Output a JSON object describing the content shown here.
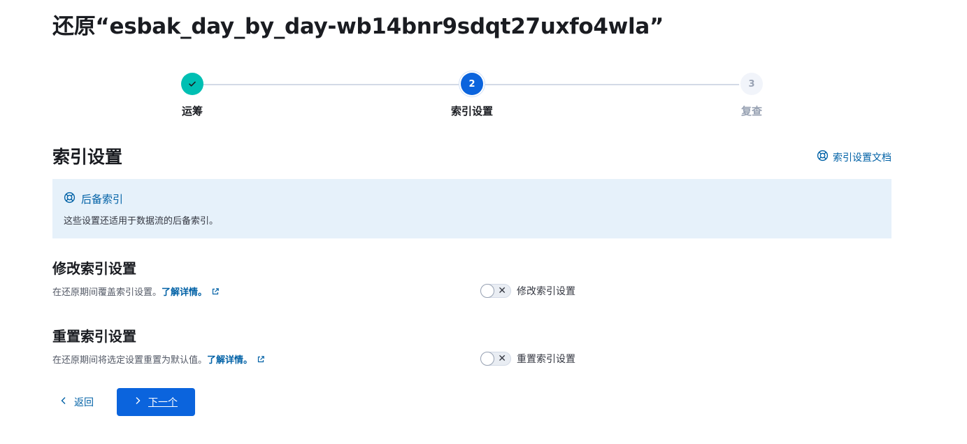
{
  "page": {
    "title": "还原“esbak_day_by_day-wb14bnr9sdqt27uxfo4wla”"
  },
  "stepper": {
    "steps": [
      {
        "label": "运筹",
        "status": "complete",
        "marker": "✓"
      },
      {
        "label": "索引设置",
        "status": "current",
        "marker": "2"
      },
      {
        "label": "复查",
        "status": "future",
        "marker": "3"
      }
    ]
  },
  "section": {
    "title": "索引设置",
    "docs_link": "索引设置文档",
    "docs_icon": "help-lifebuoy-icon"
  },
  "callout": {
    "title": "后备索引",
    "body": "这些设置还适用于数据流的后备索引。",
    "icon": "help-lifebuoy-icon"
  },
  "modify": {
    "title": "修改索引设置",
    "description": "在还原期间覆盖索引设置。",
    "learn_more": "了解详情。",
    "switch_label": "修改索引设置",
    "switch_on": false
  },
  "reset": {
    "title": "重置索引设置",
    "description": "在还原期间将选定设置重置为默认值。",
    "learn_more": "了解详情。",
    "switch_label": "重置索引设置",
    "switch_on": false
  },
  "footer": {
    "back_label": "返回",
    "next_label": "下一个"
  },
  "colors": {
    "accent": "#0b64dd",
    "link": "#0061a6",
    "success": "#00bfb3",
    "callout_bg": "#e6f1fa"
  }
}
